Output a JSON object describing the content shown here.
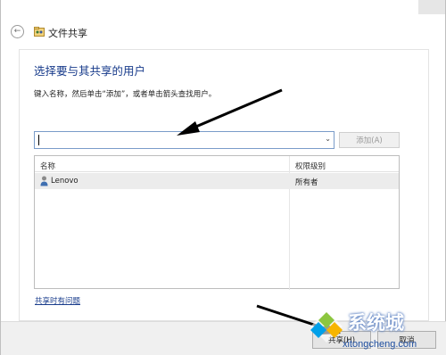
{
  "window": {
    "title": "文件共享"
  },
  "page": {
    "heading": "选择要与其共享的用户",
    "instruction": "键入名称，然后单击“添加”，或者单击箭头查找用户。"
  },
  "user_input": {
    "value": ""
  },
  "add_button": {
    "label": "添加(A)"
  },
  "table": {
    "headers": {
      "name": "名称",
      "permission": "权限级别"
    },
    "rows": [
      {
        "name": "Lenovo",
        "permission": "所有者"
      }
    ]
  },
  "help_link": "共享时有问题",
  "footer": {
    "share_label": "共享(H)",
    "cancel_label": "取消"
  },
  "watermark": {
    "brand": "系统城",
    "url": "xitongcheng.com"
  },
  "icons": {
    "back": "back-arrow-icon",
    "share": "file-share-icon",
    "user": "user-icon",
    "dropdown": "chevron-down-icon"
  },
  "colors": {
    "heading": "#1a3d8c",
    "link": "#1a3d8c",
    "input_border": "#7a9cc9",
    "footer_bg": "#f0f0f0"
  }
}
